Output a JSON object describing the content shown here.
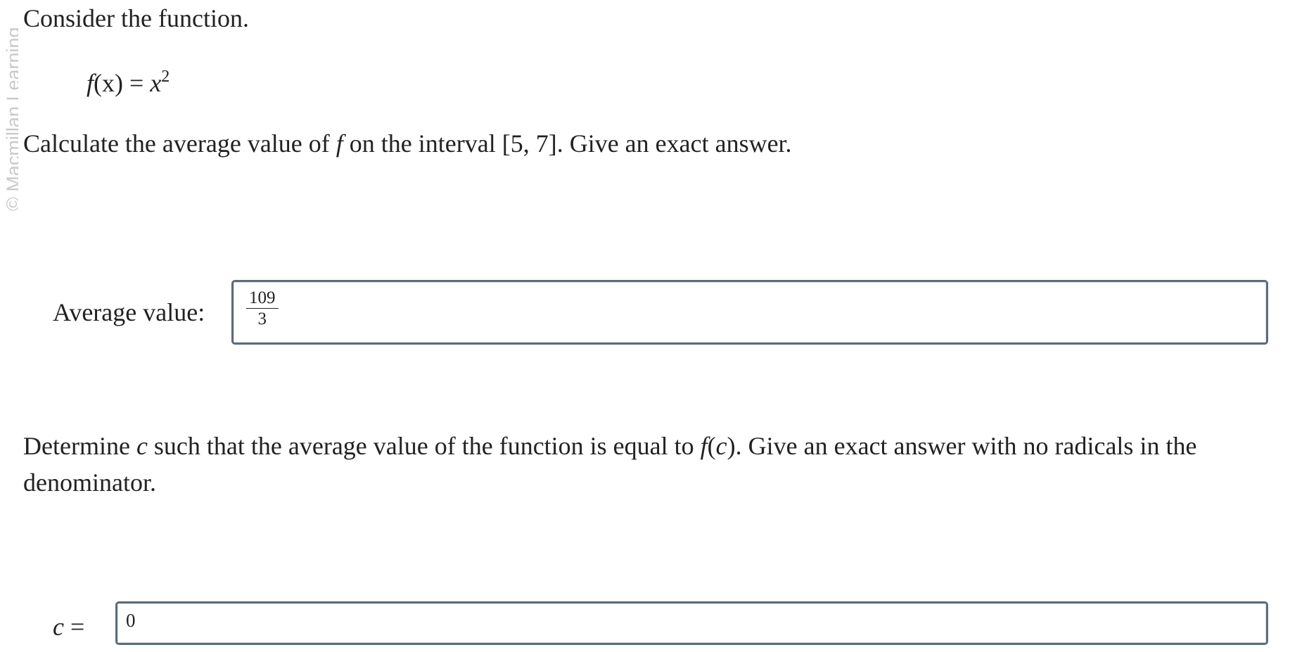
{
  "watermark": "© Macmillan Learning",
  "intro": "Consider the function.",
  "equation": {
    "lhs_func": "f",
    "lhs_arg": "(x)",
    "equals": "=",
    "rhs_base": "x",
    "rhs_exp": "2"
  },
  "question1": {
    "before": "Calculate the average value of ",
    "var": "f",
    "after": " on the interval [5, 7]. Give an exact answer."
  },
  "answer1": {
    "label": "Average value:",
    "numerator": "109",
    "denominator": "3"
  },
  "question2": {
    "part_a": "Determine ",
    "var_c": "c",
    "part_b": " such that the average value of the function is equal to ",
    "func": "f",
    "func_arg_open": "(",
    "func_arg_var": "c",
    "func_arg_close": ")",
    "part_c": ". Give an exact answer with no radicals in the denominator."
  },
  "answer2": {
    "label_var": "c",
    "label_eq": " =",
    "value": "0"
  }
}
